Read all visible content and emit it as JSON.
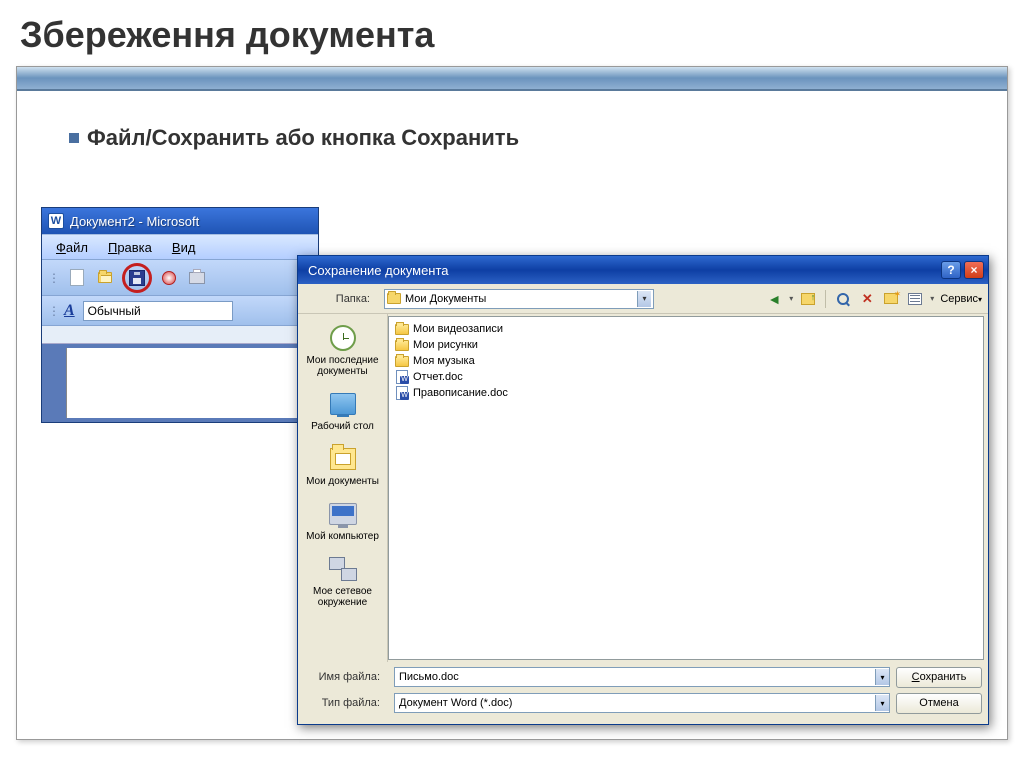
{
  "slide": {
    "title": "Збереження документа",
    "bullet": "Файл/Сохранить  або кнопка Сохранить"
  },
  "word": {
    "title": "Документ2 - Microsoft",
    "menu": [
      "Файл",
      "Правка",
      "Вид"
    ],
    "style": "Обычный"
  },
  "dialog": {
    "title": "Сохранение документа",
    "help": "?",
    "close": "×",
    "folder_label": "Папка:",
    "folder_value": "Мои Документы",
    "service": "Сервис",
    "sidebar": [
      {
        "label": "Мои последние документы"
      },
      {
        "label": "Рабочий стол"
      },
      {
        "label": "Мои документы"
      },
      {
        "label": "Мой компьютер"
      },
      {
        "label": "Мое сетевое окружение"
      }
    ],
    "files": [
      {
        "label": "Мои видеозаписи",
        "kind": "folder"
      },
      {
        "label": "Мои рисунки",
        "kind": "folder"
      },
      {
        "label": "Моя музыка",
        "kind": "folder"
      },
      {
        "label": "Отчет.doc",
        "kind": "doc"
      },
      {
        "label": "Правописание.doc",
        "kind": "doc"
      }
    ],
    "filename_label": "Имя файла:",
    "filename_value": "Письмо.doc",
    "filetype_label": "Тип файла:",
    "filetype_value": "Документ Word (*.doc)",
    "save_btn": "Сохранить",
    "cancel_btn": "Отмена"
  }
}
